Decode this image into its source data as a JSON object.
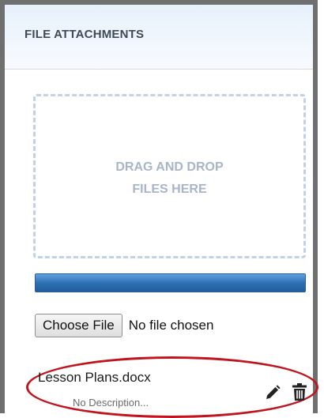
{
  "panel": {
    "title": "FILE ATTACHMENTS"
  },
  "dropzone": {
    "line1": "DRAG AND DROP",
    "line2": "FILES HERE"
  },
  "upload": {
    "progress_fraction": 1.0,
    "choose_button_label": "Choose File",
    "status_text": "No file chosen"
  },
  "attachments": [
    {
      "file_name": "Lesson Plans.docx",
      "description": "No Description...",
      "edit_icon": "pencil-icon",
      "delete_icon": "trash-icon"
    }
  ],
  "colors": {
    "highlight": "#c0141f",
    "progress": "#2e70b5"
  }
}
